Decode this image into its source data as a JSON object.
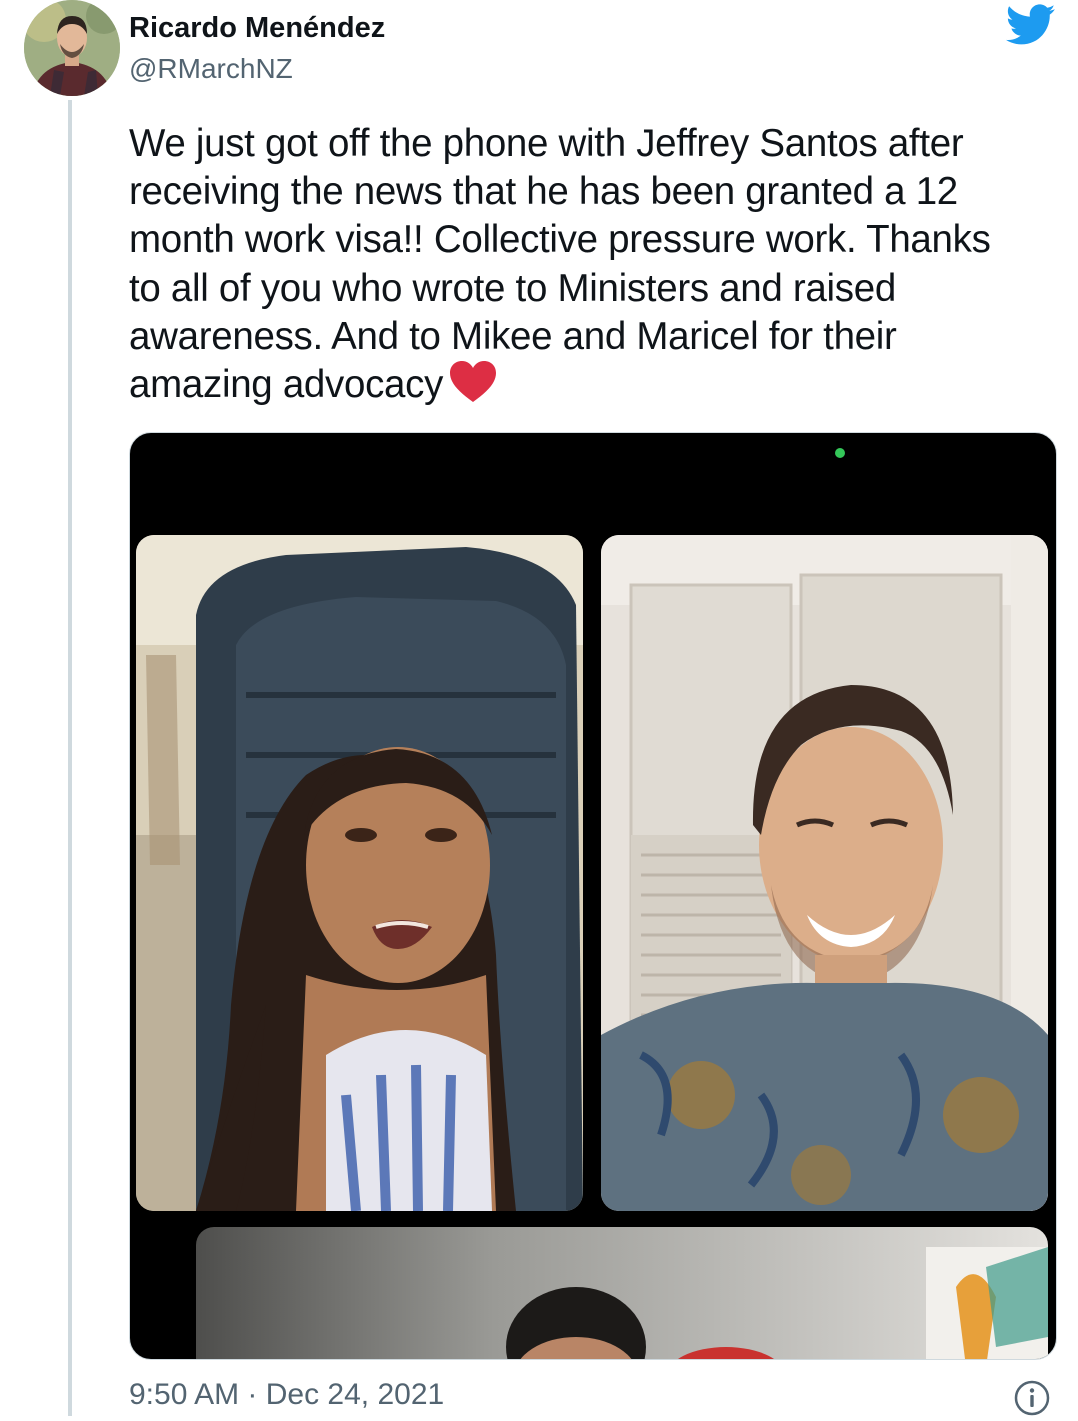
{
  "author": {
    "name": "Ricardo Menéndez",
    "handle": "@RMarchNZ"
  },
  "tweet": {
    "lines": [
      "We just got off the phone with Jeffrey Santos after",
      "receiving the news that he has been granted a 12",
      "month work visa!! Collective pressure work. Thanks",
      "to all of you who wrote to Ministers and raised",
      "awareness. And to Mikee and Maricel for their",
      "amazing advocacy"
    ],
    "emoji": "heart"
  },
  "footer": {
    "timestamp": "9:50 AM · Dec 24, 2021"
  },
  "icons": {
    "brand": "twitter-bird-icon",
    "info": "info-icon"
  },
  "colors": {
    "twitter_blue": "#1d9bf0",
    "text": "#0f1419",
    "secondary": "#536471",
    "heart": "#dd2e44"
  }
}
